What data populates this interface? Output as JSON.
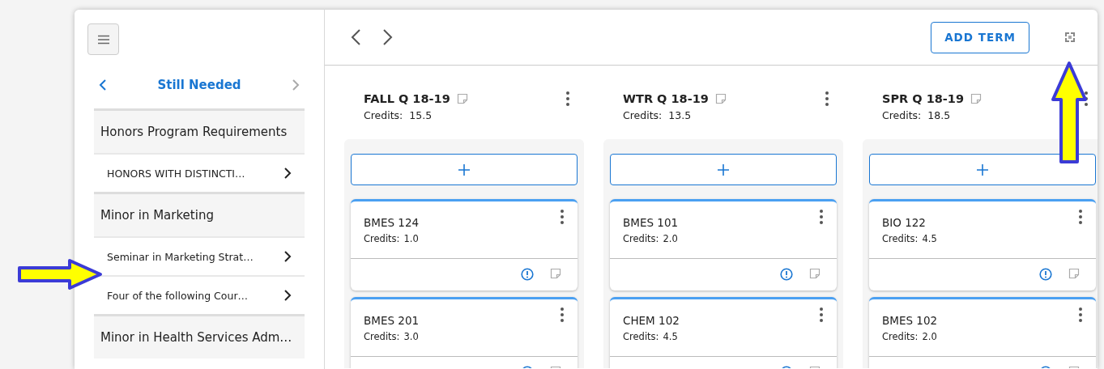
{
  "sidebar": {
    "nav": {
      "title": "Still Needed",
      "prev_disabled": false,
      "next_disabled": true
    },
    "sections": [
      {
        "title": "Honors Program Requirements",
        "items": [
          {
            "label": "HONORS WITH DISTINCTI…"
          }
        ]
      },
      {
        "title": "Minor in Marketing",
        "items": [
          {
            "label": "Seminar in Marketing Strat…"
          },
          {
            "label": "Four of the following Cour…"
          }
        ]
      },
      {
        "title": "Minor in Health Services Adm…"
      }
    ]
  },
  "toolbar": {
    "add_button": "ADD TERM"
  },
  "terms": [
    {
      "title": "FALL Q 18-19",
      "credits_label": "Credits:",
      "credits": "15.5",
      "courses": [
        {
          "code": "BMES 124",
          "credits_label": "Credits:",
          "credits": "1.0"
        },
        {
          "code": "BMES 201",
          "credits_label": "Credits:",
          "credits": "3.0"
        }
      ]
    },
    {
      "title": "WTR Q 18-19",
      "credits_label": "Credits:",
      "credits": "13.5",
      "courses": [
        {
          "code": "BMES 101",
          "credits_label": "Credits:",
          "credits": "2.0"
        },
        {
          "code": "CHEM 102",
          "credits_label": "Credits:",
          "credits": "4.5"
        }
      ]
    },
    {
      "title": "SPR Q 18-19",
      "credits_label": "Credits:",
      "credits": "18.5",
      "courses": [
        {
          "code": "BIO 122",
          "credits_label": "Credits:",
          "credits": "4.5"
        },
        {
          "code": "BMES 102",
          "credits_label": "Credits:",
          "credits": "2.0"
        }
      ]
    }
  ],
  "annotations": [
    {
      "kind": "arrow-right"
    },
    {
      "kind": "arrow-up"
    }
  ]
}
